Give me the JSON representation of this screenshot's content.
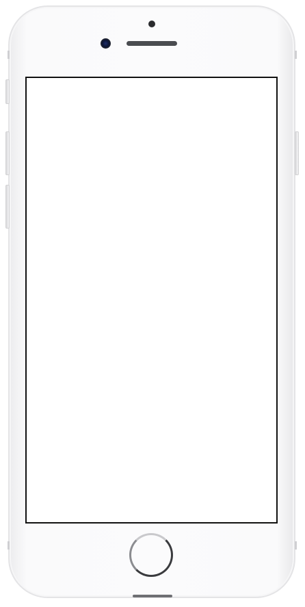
{
  "device": {
    "model": "iphone-silver",
    "colors": {
      "frame": "#fbfbfc",
      "frame_edge": "#e4e4e6",
      "screen_border": "#111111",
      "screen": "#ffffff",
      "speaker": "#4a4c50",
      "home_ring": "#3a3b3e"
    },
    "icons": {
      "speaker": "speaker-grille-icon",
      "camera": "front-camera-icon",
      "sensor": "proximity-sensor-icon",
      "home": "home-button-icon"
    }
  }
}
